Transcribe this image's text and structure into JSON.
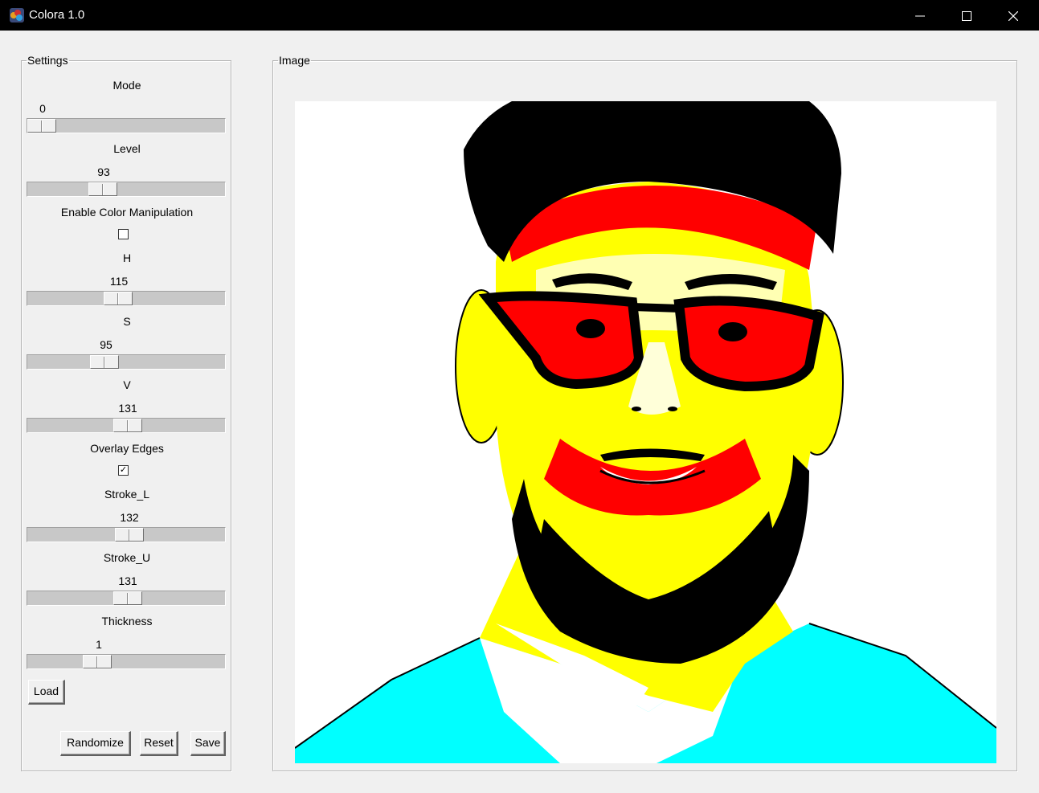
{
  "window": {
    "title": "Colora 1.0",
    "icon": "colora-app-icon"
  },
  "settings": {
    "legend": "Settings",
    "mode": {
      "label": "Mode",
      "value": "0",
      "fraction": 0.0
    },
    "level": {
      "label": "Level",
      "value": "93",
      "fraction": 0.36
    },
    "color_manip": {
      "label": "Enable Color Manipulation",
      "checked": false,
      "mark": ""
    },
    "h": {
      "label": "H",
      "value": "115",
      "fraction": 0.45
    },
    "s": {
      "label": "S",
      "value": "95",
      "fraction": 0.37
    },
    "v": {
      "label": "V",
      "value": "131",
      "fraction": 0.51
    },
    "overlay": {
      "label": "Overlay Edges",
      "checked": true,
      "mark": "✓"
    },
    "stroke_l": {
      "label": "Stroke_L",
      "value": "132",
      "fraction": 0.52
    },
    "stroke_u": {
      "label": "Stroke_U",
      "value": "131",
      "fraction": 0.51
    },
    "thickness": {
      "label": "Thickness",
      "value": "1",
      "fraction": 0.33
    },
    "load_label": "Load",
    "randomize_label": "Randomize",
    "reset_label": "Reset",
    "save_label": "Save"
  },
  "image_panel": {
    "legend": "Image"
  },
  "colors": {
    "black": "#000000",
    "red": "#ff0000",
    "yellow": "#ffff00",
    "cyan": "#00ffff",
    "white": "#ffffff"
  }
}
